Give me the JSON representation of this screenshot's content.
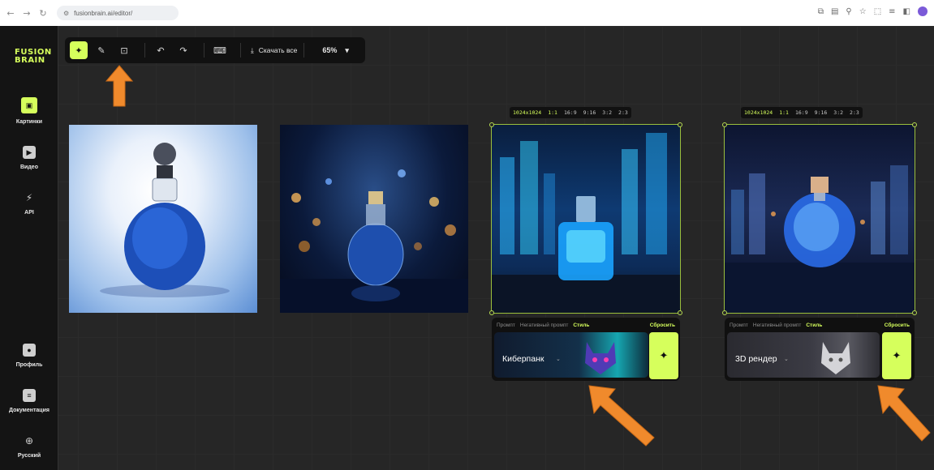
{
  "browser": {
    "back_icon": "←",
    "forward_icon": "→",
    "reload_icon": "↻",
    "site_icon": "⚙",
    "url": "fusionbrain.ai/editor/",
    "actions": [
      "⧉",
      "▤",
      "⚲",
      "☆",
      "⬚",
      "≡",
      "◧"
    ]
  },
  "app": {
    "logo_line1": "FUSION",
    "logo_line2": "BRAIN",
    "accent": "#d6ff5c",
    "sidebar": {
      "items": [
        {
          "label": "Картинки",
          "icon": "image-icon",
          "glyph": "▣"
        },
        {
          "label": "Видео",
          "icon": "video-icon",
          "glyph": "▶"
        },
        {
          "label": "API",
          "icon": "api-icon",
          "glyph": "⚡"
        },
        {
          "label": "Профиль",
          "icon": "profile-icon",
          "glyph": "●"
        },
        {
          "label": "Документация",
          "icon": "document-icon",
          "glyph": "≡"
        },
        {
          "label": "Русский",
          "icon": "globe-icon",
          "glyph": "⊕"
        }
      ]
    },
    "toolbar": {
      "tools": [
        "✦",
        "✎",
        "⊡",
        "↶",
        "↷",
        "⌨"
      ],
      "download_icon": "⤓",
      "download_label": "Скачать все",
      "zoom": "65%",
      "zoom_chevron": "▾"
    },
    "ratio_bar": {
      "size": "1024x1024",
      "ratios": [
        "1:1",
        "16:9",
        "9:16",
        "3:2",
        "2:3"
      ]
    },
    "panel_left": {
      "tabs": [
        "Промпт",
        "Негативный промпт",
        "Стиль"
      ],
      "reset": "Сбросить",
      "style_name": "Киберпанк",
      "chevron": "⌄",
      "generate_icon": "✦"
    },
    "panel_right": {
      "tabs": [
        "Промпт",
        "Негативный промпт",
        "Стиль"
      ],
      "reset": "Сбросить",
      "style_name": "3D рендер",
      "chevron": "⌄",
      "generate_icon": "✦"
    }
  }
}
